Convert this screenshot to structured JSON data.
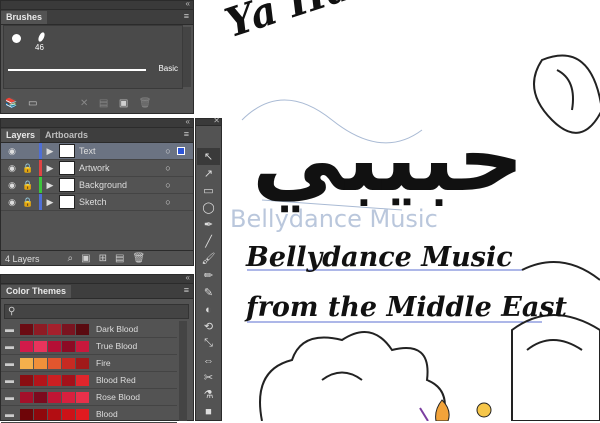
{
  "brushes": {
    "tab": "Brushes",
    "brush_size": "46",
    "stroke_label": "Basic"
  },
  "layers": {
    "tabs": [
      "Layers",
      "Artboards"
    ],
    "rows": [
      {
        "name": "Text",
        "color": "#4f6fd6",
        "selected": true,
        "locked": false
      },
      {
        "name": "Artwork",
        "color": "#e04444",
        "selected": false,
        "locked": true
      },
      {
        "name": "Background",
        "color": "#3cc43c",
        "selected": false,
        "locked": true
      },
      {
        "name": "Sketch",
        "color": "#4f6fd6",
        "selected": false,
        "locked": true
      }
    ],
    "count": "4 Layers"
  },
  "color_themes": {
    "tab": "Color Themes",
    "search_placeholder": "",
    "themes": [
      {
        "name": "Dark Blood",
        "swatches": [
          "#6b0b12",
          "#8e1b24",
          "#a5202c",
          "#7a1420",
          "#5a0a10"
        ]
      },
      {
        "name": "True Blood",
        "swatches": [
          "#d11a4a",
          "#e8345c",
          "#b50f35",
          "#8c0a24",
          "#c9183c"
        ]
      },
      {
        "name": "Fire",
        "swatches": [
          "#f4b04c",
          "#f0903a",
          "#e2562e",
          "#c72a22",
          "#a01a1a"
        ]
      },
      {
        "name": "Blood Red",
        "swatches": [
          "#8a0e12",
          "#b3141a",
          "#cc1f22",
          "#a3111a",
          "#e0262c"
        ]
      },
      {
        "name": "Rose Blood",
        "swatches": [
          "#a3102a",
          "#7c0a1e",
          "#c01634",
          "#d8203e",
          "#e8304a"
        ]
      },
      {
        "name": "Blood",
        "swatches": [
          "#6e0508",
          "#8f080c",
          "#b30d12",
          "#cc1218",
          "#e01a20"
        ]
      }
    ]
  },
  "artwork": {
    "arabic": "حبيبي",
    "title": "Ya Habibi",
    "ghost_line1": "Bellydance Music",
    "line1": "Bellydance Music",
    "line2": "from the Middle East"
  },
  "tools": [
    "selection-tool",
    "direct-selection-tool",
    "rectangle-tool",
    "ellipse-tool",
    "pen-tool",
    "line-tool",
    "paintbrush-tool",
    "pencil-tool",
    "blob-brush-tool",
    "eraser-tool",
    "rotate-tool",
    "scale-tool",
    "width-tool",
    "scissors-tool",
    "eyedropper-tool",
    "fill-stroke-swatch"
  ]
}
